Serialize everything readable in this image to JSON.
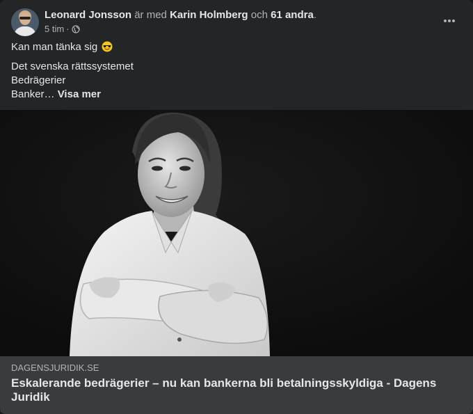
{
  "post": {
    "author": "Leonard Jonsson",
    "with_text": "är med",
    "tagged_name": "Karin Holmberg",
    "and_text": "och",
    "others": "61 andra",
    "period": ".",
    "time": "5 tim",
    "separator": "·",
    "audience_icon": "globe-icon",
    "more_icon": "more-options-icon",
    "body": {
      "line1": "Kan man tänka sig",
      "emoji": "smiling-face-with-sunglasses-icon",
      "line2": "Det svenska rättssystemet",
      "line3": "Bedrägerier",
      "line4": "Banker…",
      "see_more": "Visa mer"
    }
  },
  "link_preview": {
    "image": "black-and-white-portrait-woman-arms-crossed",
    "domain": "DAGENSJURIDIK.SE",
    "title": "Eskalerande bedrägerier – nu kan bankerna bli betalningsskyldiga - Dagens Juridik"
  },
  "colors": {
    "card_bg": "#242526",
    "link_bg": "#3a3b3c",
    "primary_text": "#e4e6eb",
    "secondary_text": "#b0b3b8"
  }
}
